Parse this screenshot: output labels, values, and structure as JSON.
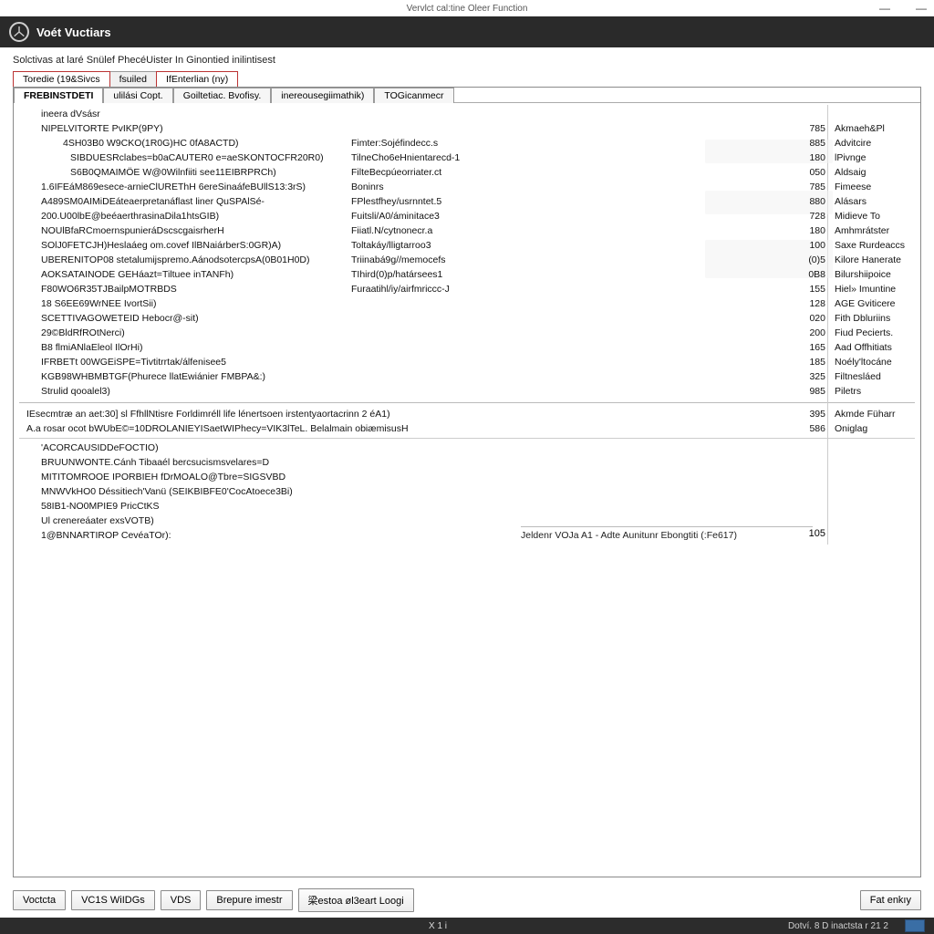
{
  "window": {
    "title": "Vervlct cal:tine Oleer Function",
    "ctrl_min": "—",
    "ctrl_close": "—"
  },
  "brand": {
    "title": "Voét Vuctiars"
  },
  "subheader": "Solctivas at laré Snülef PhecéUister In Ginontied inilintisest",
  "outer_tabs": [
    {
      "label": "Toredie (19&Sivcs"
    },
    {
      "label": "fsuiled"
    },
    {
      "label": "IfEnterlian (ny)"
    }
  ],
  "inner_tabs": [
    {
      "label": "FREBINSTDETI"
    },
    {
      "label": "ulilási Copt."
    },
    {
      "label": "Goiltetiac. Bvofisy."
    },
    {
      "label": "inereousegiimathik)"
    },
    {
      "label": "TOGicanmecr"
    }
  ],
  "rows": [
    {
      "indent": 1,
      "c1": "ineera dVsásr"
    },
    {
      "indent": 1,
      "c1": "NIPELVITORTE PvIKP(9PY)",
      "c3": "785",
      "c4": "Akmaeh&Pl"
    },
    {
      "indent": 2,
      "c1": "4SH03B0 W9CKO(1R0G)HC 0fA8ACTD)",
      "c2": "Fimter:Sojéfindecc.s",
      "c3": "885",
      "c4": "Advitcire"
    },
    {
      "indent": 3,
      "c1": "SIBDUESRclabes=b0aCAUTER0 e=aeSKONTOCFR20R0)",
      "c2": "TilneCho6eHnientarecd-1",
      "c3": "180",
      "c4": "lPivnge"
    },
    {
      "indent": 3,
      "c1": "S6B0QMAIMÖE W@0Wilnfiiti see11EIBRPRCh)",
      "c2": "FilteBecpúeorriater.ct",
      "c3": "050",
      "c4": "Aldsaig"
    },
    {
      "indent": 1,
      "c1": "1.6IFEáM869esece-arnieClUREThH 6ereSinaáfeBUllS13:3rS)",
      "c2": "Boninrs",
      "c3": "785",
      "c4": "Fimeese"
    },
    {
      "indent": 1,
      "c1": "A489SM0AIMiDEáteaerpretanáflast liner QuSPAlSé-",
      "c2": "FPlestfhey/usrnntet.5",
      "c3": "880",
      "c4": "Alásars"
    },
    {
      "indent": 1,
      "c1": "200.U00lbE@beéaerthrasinaDila1htsGIB)",
      "c2": "Fuitsli/A0/áminitace3",
      "c3": "728",
      "c4": "Midieve To"
    },
    {
      "indent": 1,
      "c1": "NOUlBfaRCmoernspunieráDscscgaisrherH",
      "c2": "Fiiatl.N/cytnonecr.a",
      "c3": "180",
      "c4": "Amhmrátster"
    },
    {
      "indent": 1,
      "c1": "SOlJ0FETCJH)Heslaáeg om.covef IlBNaiárberS:0GR)A)",
      "c2": "Toltakáy/lligtarroo3",
      "c3": "100",
      "c4": "Saxe Rurdeaccs"
    },
    {
      "indent": 1,
      "c1": "UBERENITOP08 stetalumijspremo.AánodsotercpsA(0B01H0D)",
      "c2": "Triinabá9g//memocefs",
      "c3": "(0)5",
      "c4": "Kilore Hanerate"
    },
    {
      "indent": 1,
      "c1": "AOKSATAINODE GEHáazt=Tiltuee inTANFh)",
      "c2": "TIhird(0)p/határsees1",
      "c3": "0B8",
      "c4": "Bilurshiipoice"
    },
    {
      "indent": 1,
      "c1": "F80WO6R35TJBailpMOTRBDS",
      "c2": "Furaatihl/iy/airfmriccc-J",
      "c3": "155",
      "c4": "Hiel» Imuntine"
    },
    {
      "indent": 1,
      "c1": "18 S6EE69WrNEE IvortSii)",
      "c3": "128",
      "c4": "AGE Gviticere"
    },
    {
      "indent": 1,
      "c1": "SCETTIVAGOWETEID Hebocr@-sit)",
      "c3": "020",
      "c4": "Fith Dbluriins"
    },
    {
      "indent": 1,
      "c1": "29©BldRfROtNerci)",
      "c3": "200",
      "c4": "Fiud Pecierts."
    },
    {
      "indent": 1,
      "c1": "B8 flmiANlaEleol IlOrHi)",
      "c3": "165",
      "c4": "Aad Offhitiats"
    },
    {
      "indent": 1,
      "c1": "IFRBETt 00WGEiSPE=Tivtitrrtak/álfenisee5",
      "c3": "185",
      "c4": "Noély'ltocáne"
    },
    {
      "indent": 1,
      "c1": "KGB98WHBMBTGF(Phurece llatEwiánier FMBPA&:)",
      "c3": "325",
      "c4": "Filtnesláed"
    },
    {
      "indent": 1,
      "c1": "Strulid qooalel3)",
      "c3": "985",
      "c4": "Piletrs"
    },
    {
      "indent": 0,
      "c1": "IEsecmtræ an aet:30] sl FfhllNtisre Forldimréll life lénertsoen irstentyaortacrinn 2 éA1)",
      "c3": "395",
      "c4": "Akmde Füharr",
      "divider_before": true
    },
    {
      "indent": 0,
      "c1": "A.a rosar ocot bWUbE©=10DROLANIEYISaetWIPhecy=VIK3lTeL.  Belalmain obiæmisusH",
      "c3": "586",
      "c4": "Oniglag",
      "rule_after": true
    },
    {
      "indent": 1,
      "c1": "'ACORCAUSIDDeFOCTIO)"
    },
    {
      "indent": 1,
      "c1": "BRUUNWONTE.Cánh Tibaaél bercsucismsvelares=D"
    },
    {
      "indent": 1,
      "c1": "MITITOMROOE IPORBIEH fDrMOALO@Tbre=SIGSVBD"
    },
    {
      "indent": 1,
      "c1": "MNWVkHO0 Déssitiech'Vanü (SEIKBIBFE0'CocAtoece3Bi)"
    },
    {
      "indent": 1,
      "c1": "58IB1-NO0MPIE9 PricCtKS"
    },
    {
      "indent": 1,
      "c1": "Ul crenereáater exsVOTB)"
    },
    {
      "indent": 1,
      "c1": "1@BNNARTIROP CevéaTOr):"
    }
  ],
  "annotation": {
    "label": "Jeldenr VOJa A1 -  Adte Aunitunr Ebongtiti (:Fe617)",
    "value": "105"
  },
  "buttons": {
    "b1": "Voctcta",
    "b2": "VC1S WiIDGs",
    "b3": "VDS",
    "b4": "Brepure imestr",
    "b5": "梁estoa øl3eart Loogi",
    "right": "Fat enkıy"
  },
  "status": {
    "left": "X  1  i",
    "right": "Dotví. 8 D  inactsta r 21 2"
  }
}
